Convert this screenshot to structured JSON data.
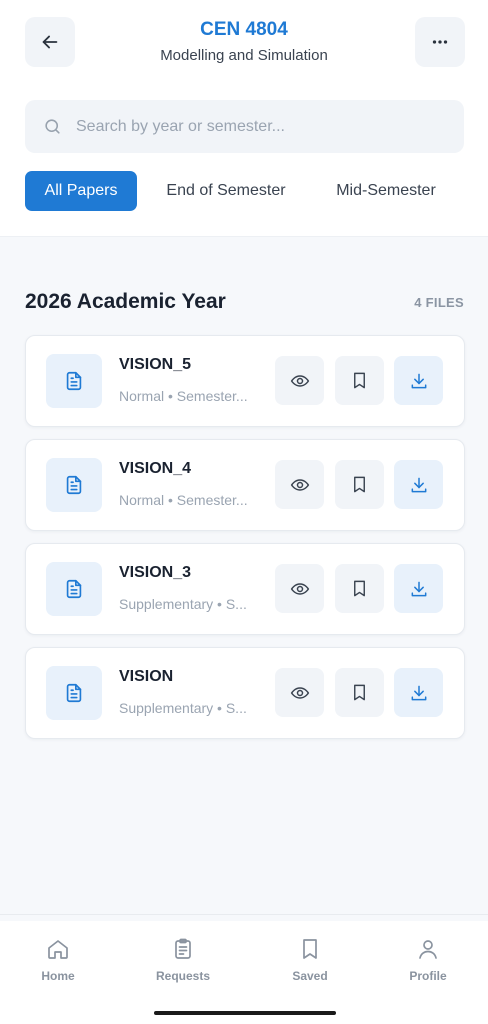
{
  "header": {
    "course_code": "CEN 4804",
    "course_name": "Modelling and Simulation",
    "back_icon": "arrow-left-icon",
    "more_icon": "more-horizontal-icon"
  },
  "search": {
    "placeholder": "Search by year or semester...",
    "value": ""
  },
  "tabs": [
    {
      "label": "All Papers",
      "active": true
    },
    {
      "label": "End of Semester",
      "active": false
    },
    {
      "label": "Mid-Semester",
      "active": false
    }
  ],
  "section": {
    "title": "2026 Academic Year",
    "count": "4 FILES"
  },
  "files": [
    {
      "name": "VISION_5",
      "meta": "Normal • Semester..."
    },
    {
      "name": "VISION_4",
      "meta": "Normal • Semester..."
    },
    {
      "name": "VISION_3",
      "meta": "Supplementary • S..."
    },
    {
      "name": "VISION",
      "meta": "Supplementary • S..."
    }
  ],
  "bottom_nav": [
    {
      "label": "Home",
      "icon": "home-icon"
    },
    {
      "label": "Requests",
      "icon": "clipboard-icon"
    },
    {
      "label": "Saved",
      "icon": "bookmark-icon"
    },
    {
      "label": "Profile",
      "icon": "user-icon"
    }
  ],
  "colors": {
    "accent": "#1f7ad4",
    "background": "#f6f8fb",
    "muted_text": "#9aa4b1"
  }
}
